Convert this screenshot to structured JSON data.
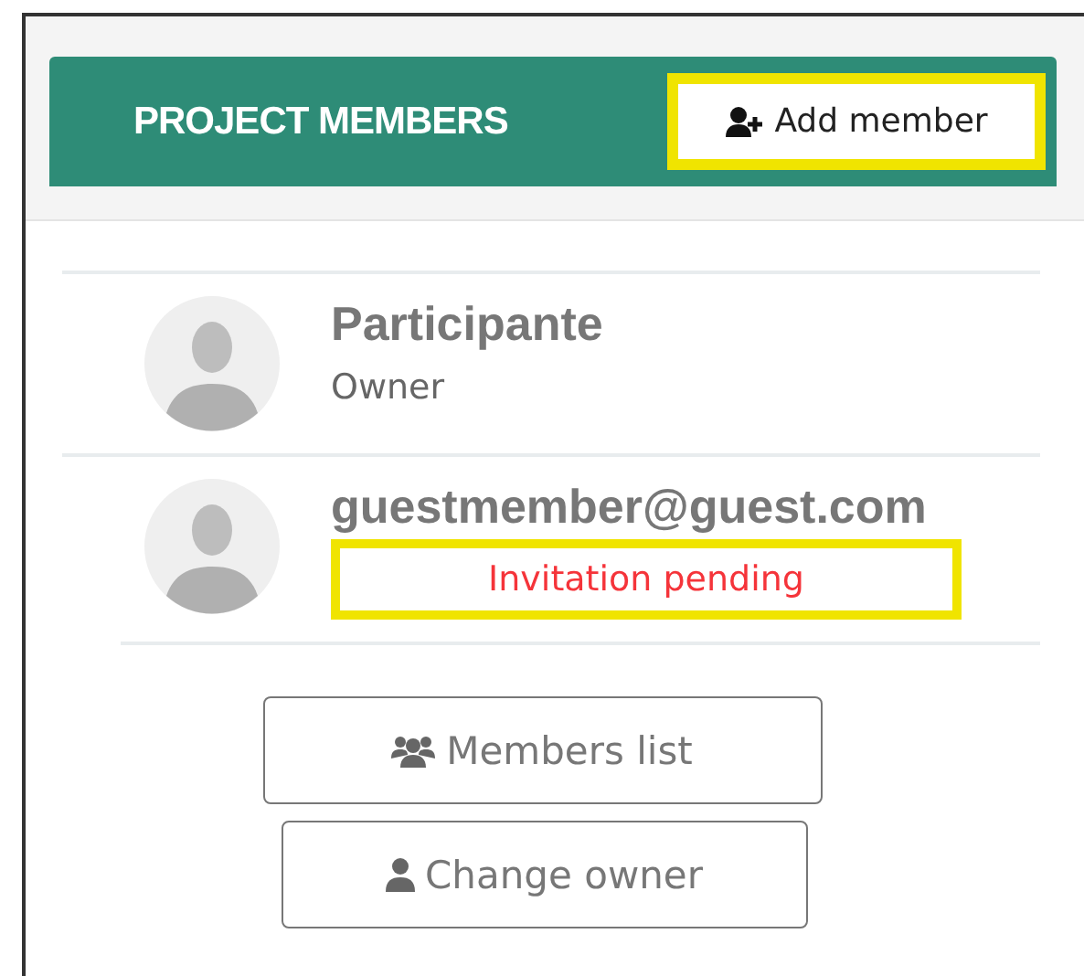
{
  "header": {
    "title": "PROJECT MEMBERS",
    "add_button": {
      "label": "Add member",
      "highlighted": true
    }
  },
  "members": [
    {
      "name": "Participante",
      "kind": "role",
      "subtitle": "Owner",
      "highlighted": false
    },
    {
      "name": "guestmember@guest.com",
      "kind": "pending",
      "subtitle": "Invitation pending",
      "highlighted": true
    }
  ],
  "actions": [
    {
      "kind": "list",
      "label": "Members list"
    },
    {
      "kind": "owner",
      "label": "Change owner"
    }
  ]
}
